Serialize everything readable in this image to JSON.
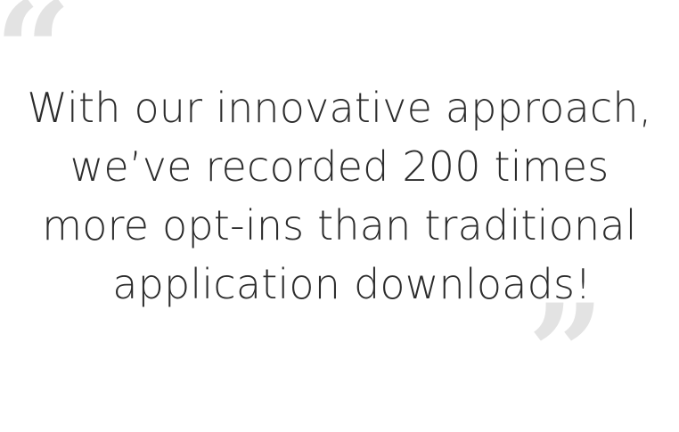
{
  "quote": {
    "open_mark": "“",
    "close_mark": "”",
    "lines": [
      "With our innovative approach,",
      "we’ve recorded 200 times",
      "more opt-ins than traditional",
      "application downloads!"
    ]
  },
  "colors": {
    "text": "#2c2c2c",
    "quote_mark": "#e3e3e3",
    "background": "#ffffff"
  }
}
